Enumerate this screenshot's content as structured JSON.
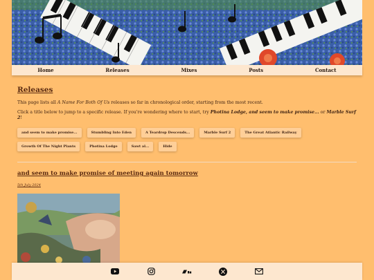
{
  "nav": {
    "items": [
      "Home",
      "Releases",
      "Mixes",
      "Posts",
      "Contact"
    ]
  },
  "page": {
    "title": "Releases",
    "intro_prefix": "This page lists all ",
    "intro_band": "A Name For Both Of Us",
    "intro_suffix": " releases so far in chronological order, starting from the most recent.",
    "jump_prefix": "Click a title below to jump to a specific release. If you're wondering where to start, try ",
    "jump_suggestion": "Photina Lodge, and seem to make promise...",
    "jump_or": " or ",
    "jump_suggestion2": "Marble Surf 2",
    "jump_end": "!"
  },
  "release_buttons": [
    "and seem to make promise...",
    "Stumbling Into Eden",
    "A Teardrop Descends...",
    "Marble Surf 2",
    "The Great Atlantic Railway",
    "Growth Of The Night Plants",
    "Photina Lodge",
    "Sawt al...",
    "Hide"
  ],
  "post": {
    "title": "and seem to make promise of meeting again tomorrow",
    "date": "5th July 2024"
  },
  "footer": {
    "icons": [
      "youtube-icon",
      "instagram-icon",
      "bandcamp-icon",
      "x-twitter-icon",
      "email-icon"
    ]
  },
  "colors": {
    "background": "#ffbe6e",
    "nav_bg": "#fde7cf",
    "button_bg": "#ffcf98",
    "heading": "#5a2a10"
  }
}
